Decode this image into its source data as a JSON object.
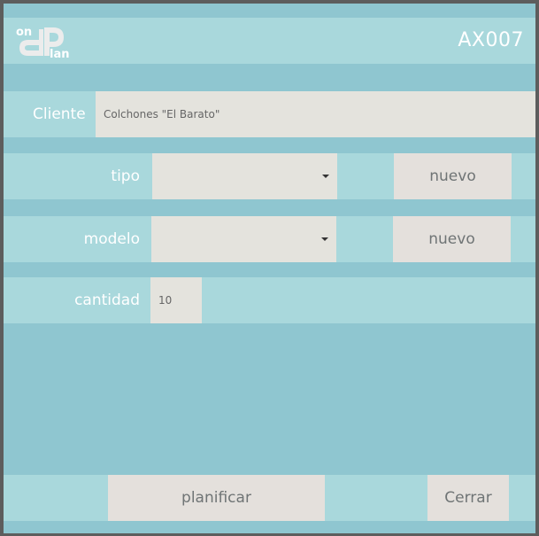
{
  "header": {
    "logo_text": "onPlan",
    "record_id": "AX007"
  },
  "form": {
    "cliente": {
      "label": "Cliente",
      "value": "Colchones \"El Barato\""
    },
    "tipo": {
      "label": "tipo",
      "selected": "",
      "new_button": "nuevo"
    },
    "modelo": {
      "label": "modelo",
      "selected": "",
      "new_button": "nuevo"
    },
    "cantidad": {
      "label": "cantidad",
      "value": "10"
    }
  },
  "actions": {
    "plan_button": "planificar",
    "close_button": "Cerrar"
  },
  "colors": {
    "background": "#8fc6d0",
    "band": "#a9d8dc",
    "field": "#e4e3dd",
    "text_light": "#ffffff",
    "frame": "#5d5d5d"
  }
}
